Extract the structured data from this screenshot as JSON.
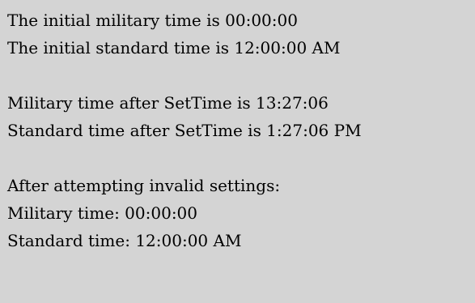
{
  "output": {
    "initial_military": "The initial military time is 00:00:00",
    "initial_standard": "The initial standard time is 12:00:00 AM",
    "settime_military": "Military time after SetTime is 13:27:06",
    "settime_standard": "Standard time after SetTime is 1:27:06 PM",
    "invalid_header": "After attempting invalid settings:",
    "invalid_military": "Military time: 00:00:00",
    "invalid_standard": "Standard time: 12:00:00 AM"
  },
  "colors": {
    "background": "#d4d4d4",
    "text": "#000000"
  }
}
